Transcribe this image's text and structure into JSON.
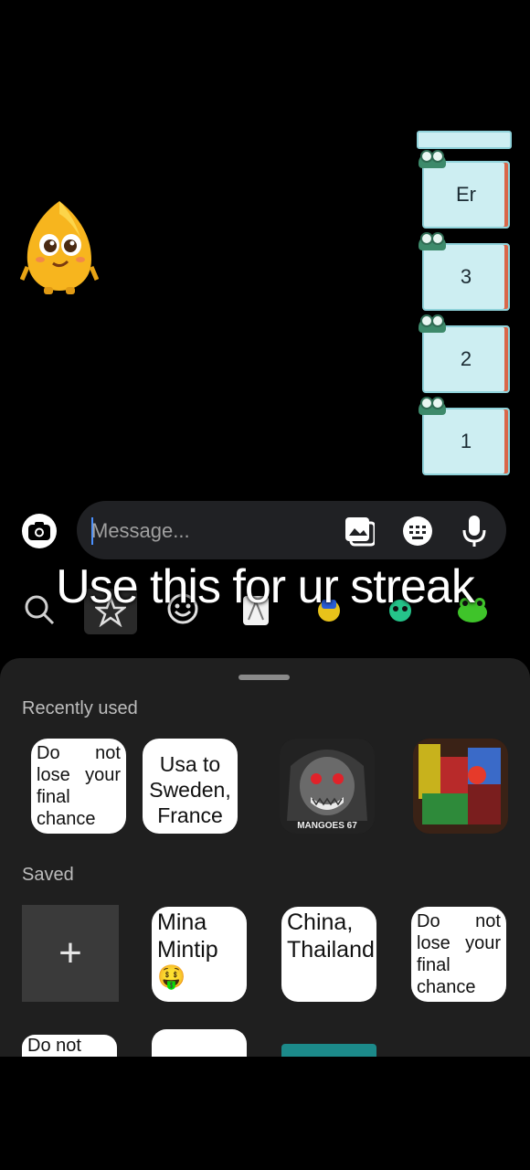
{
  "chat": {
    "stickers": [
      {
        "label": "Er"
      },
      {
        "label": "3"
      },
      {
        "label": "2"
      },
      {
        "label": "1"
      }
    ]
  },
  "composer": {
    "placeholder": "Message...",
    "icons": [
      "camera-icon",
      "gallery-icon",
      "keyboard-icon",
      "microphone-icon"
    ]
  },
  "overlay": {
    "caption": "Use this for ur streak"
  },
  "tabs": [
    "search-icon",
    "star-icon",
    "smiley-icon",
    "ghost-sticker-icon",
    "yellow-sticker-icon",
    "green-sticker-icon",
    "frog-sticker-icon"
  ],
  "panel": {
    "recent_label": "Recently used",
    "saved_label": "Saved",
    "recent": [
      {
        "text": "Do not lose your final chance"
      },
      {
        "text": "Usa to Sweden, France"
      },
      {
        "caption": "MANGOES 67"
      },
      {
        "text": ""
      }
    ],
    "saved": [
      {
        "label": "+"
      },
      {
        "text": "Mina Mintip 🤑"
      },
      {
        "text": "China, Thailand,"
      },
      {
        "text": "Do not lose your final chance"
      }
    ],
    "partial": [
      {
        "text": "Do not"
      }
    ]
  },
  "colors": {
    "background": "#000000",
    "panel": "#1f1f1f",
    "sticker_bubble": "#cdeef2"
  }
}
